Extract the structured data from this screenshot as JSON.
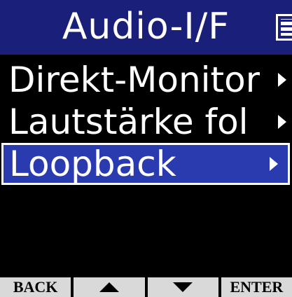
{
  "header": {
    "title": "Audio-I/F",
    "battery_icon": "battery-icon"
  },
  "menu": {
    "items": [
      {
        "label": "Direkt-Monitor",
        "selected": false
      },
      {
        "label": "Lautstärke fol",
        "selected": false
      },
      {
        "label": "Loopback",
        "selected": true
      }
    ]
  },
  "footer": {
    "back_label": "BACK",
    "up_icon": "up-arrow-icon",
    "down_icon": "down-arrow-icon",
    "enter_label": "ENTER"
  },
  "colors": {
    "header_bg": "#1a1f7a",
    "selected_bg": "#2a3bb0",
    "footer_bg": "#d9d9d9",
    "screen_bg": "#000000"
  }
}
